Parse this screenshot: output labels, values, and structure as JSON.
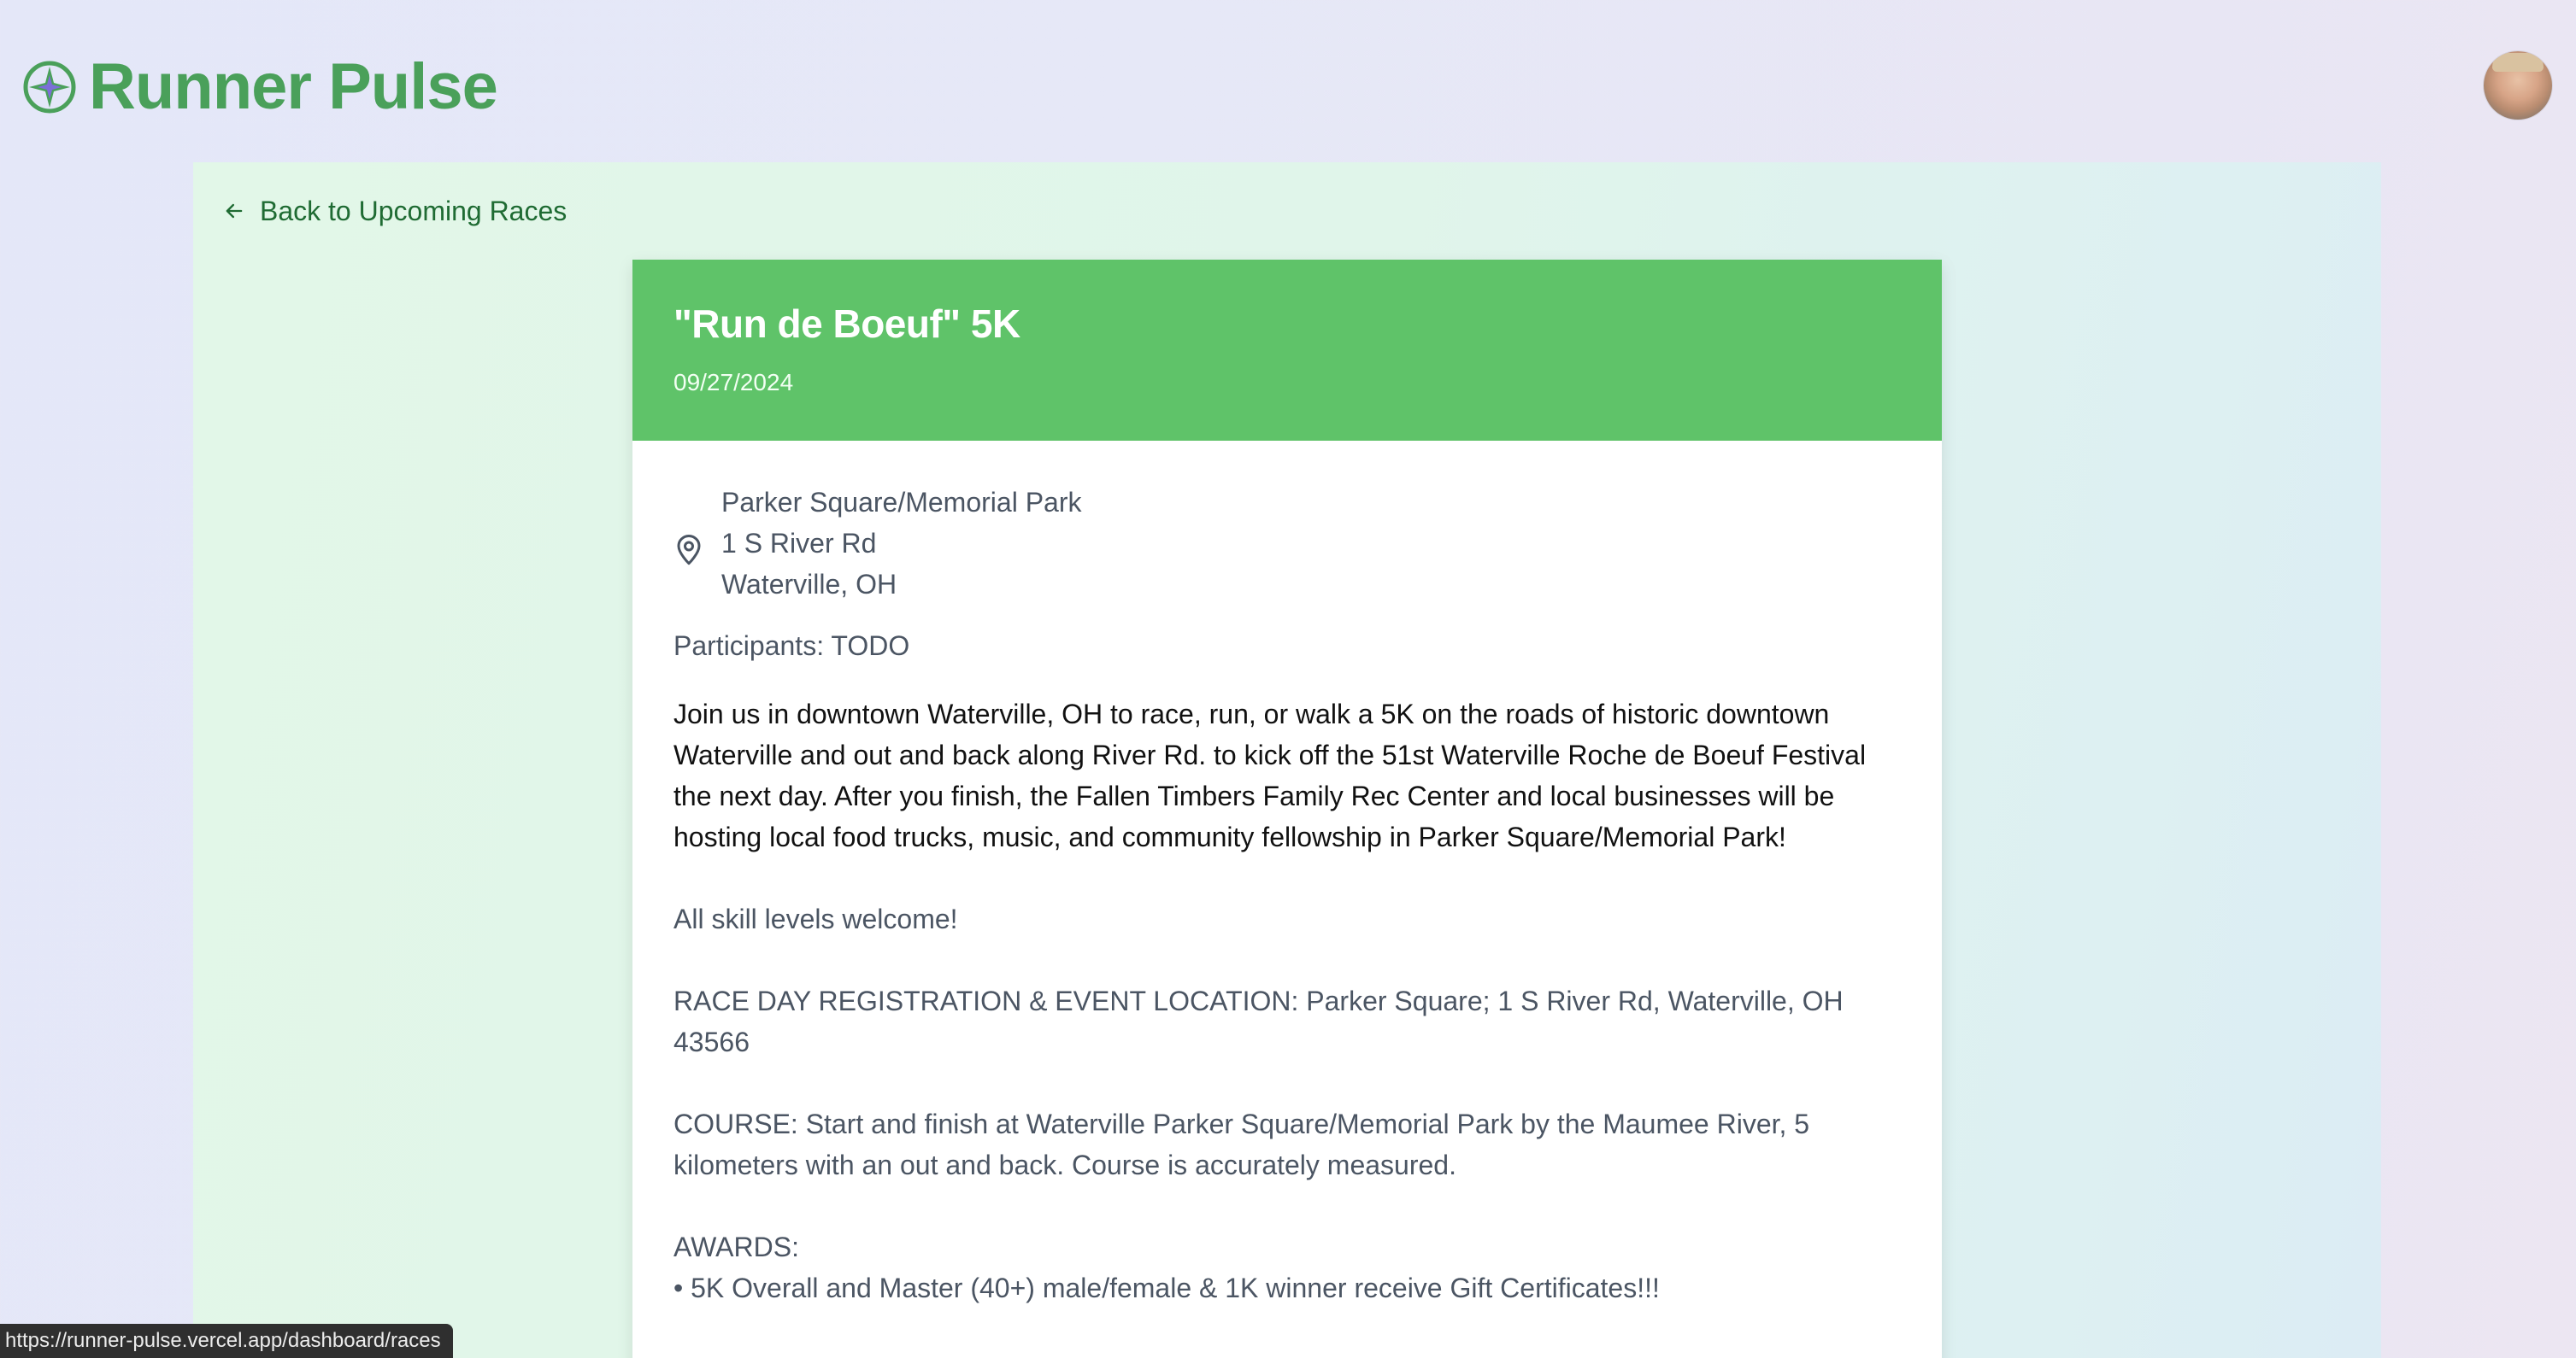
{
  "app": {
    "title": "Runner Pulse"
  },
  "nav": {
    "back_label": "Back to Upcoming Races"
  },
  "race": {
    "title": "\"Run de Boeuf\" 5K",
    "date": "09/27/2024",
    "location": {
      "venue": "Parker Square/Memorial Park",
      "street": "1 S River Rd",
      "city": "Waterville, OH"
    },
    "participants_label": "Participants: TODO",
    "description": {
      "intro": "Join us in downtown Waterville, OH to race, run, or walk a 5K on the roads of historic downtown Waterville and out and back along River Rd. to kick off the 51st Waterville Roche de Boeuf Festival the next day. After you finish, the Fallen Timbers Family Rec Center and local businesses will be hosting local food trucks, music, and community fellowship in Parker Square/Memorial Park!",
      "welcome": "All skill levels welcome!",
      "registration": "RACE DAY REGISTRATION & EVENT LOCATION: Parker Square; 1 S River Rd, Waterville, OH 43566",
      "course": "COURSE: Start and finish at Waterville Parker Square/Memorial Park by the Maumee River, 5 kilometers with an out and back. Course is accurately measured.",
      "awards_title": "AWARDS:",
      "awards_item_1": "• 5K Overall and Master (40+) male/female & 1K winner receive Gift Certificates!!!"
    }
  },
  "status_bar": {
    "url": "https://runner-pulse.vercel.app/dashboard/races"
  },
  "colors": {
    "brand_green": "#4aa05a",
    "card_header_green": "#5fc369",
    "link_green": "#1f6b33"
  },
  "icons": {
    "logo": "compass-star-icon",
    "back": "arrow-left-icon",
    "location": "map-pin-icon",
    "avatar": "user-avatar"
  }
}
